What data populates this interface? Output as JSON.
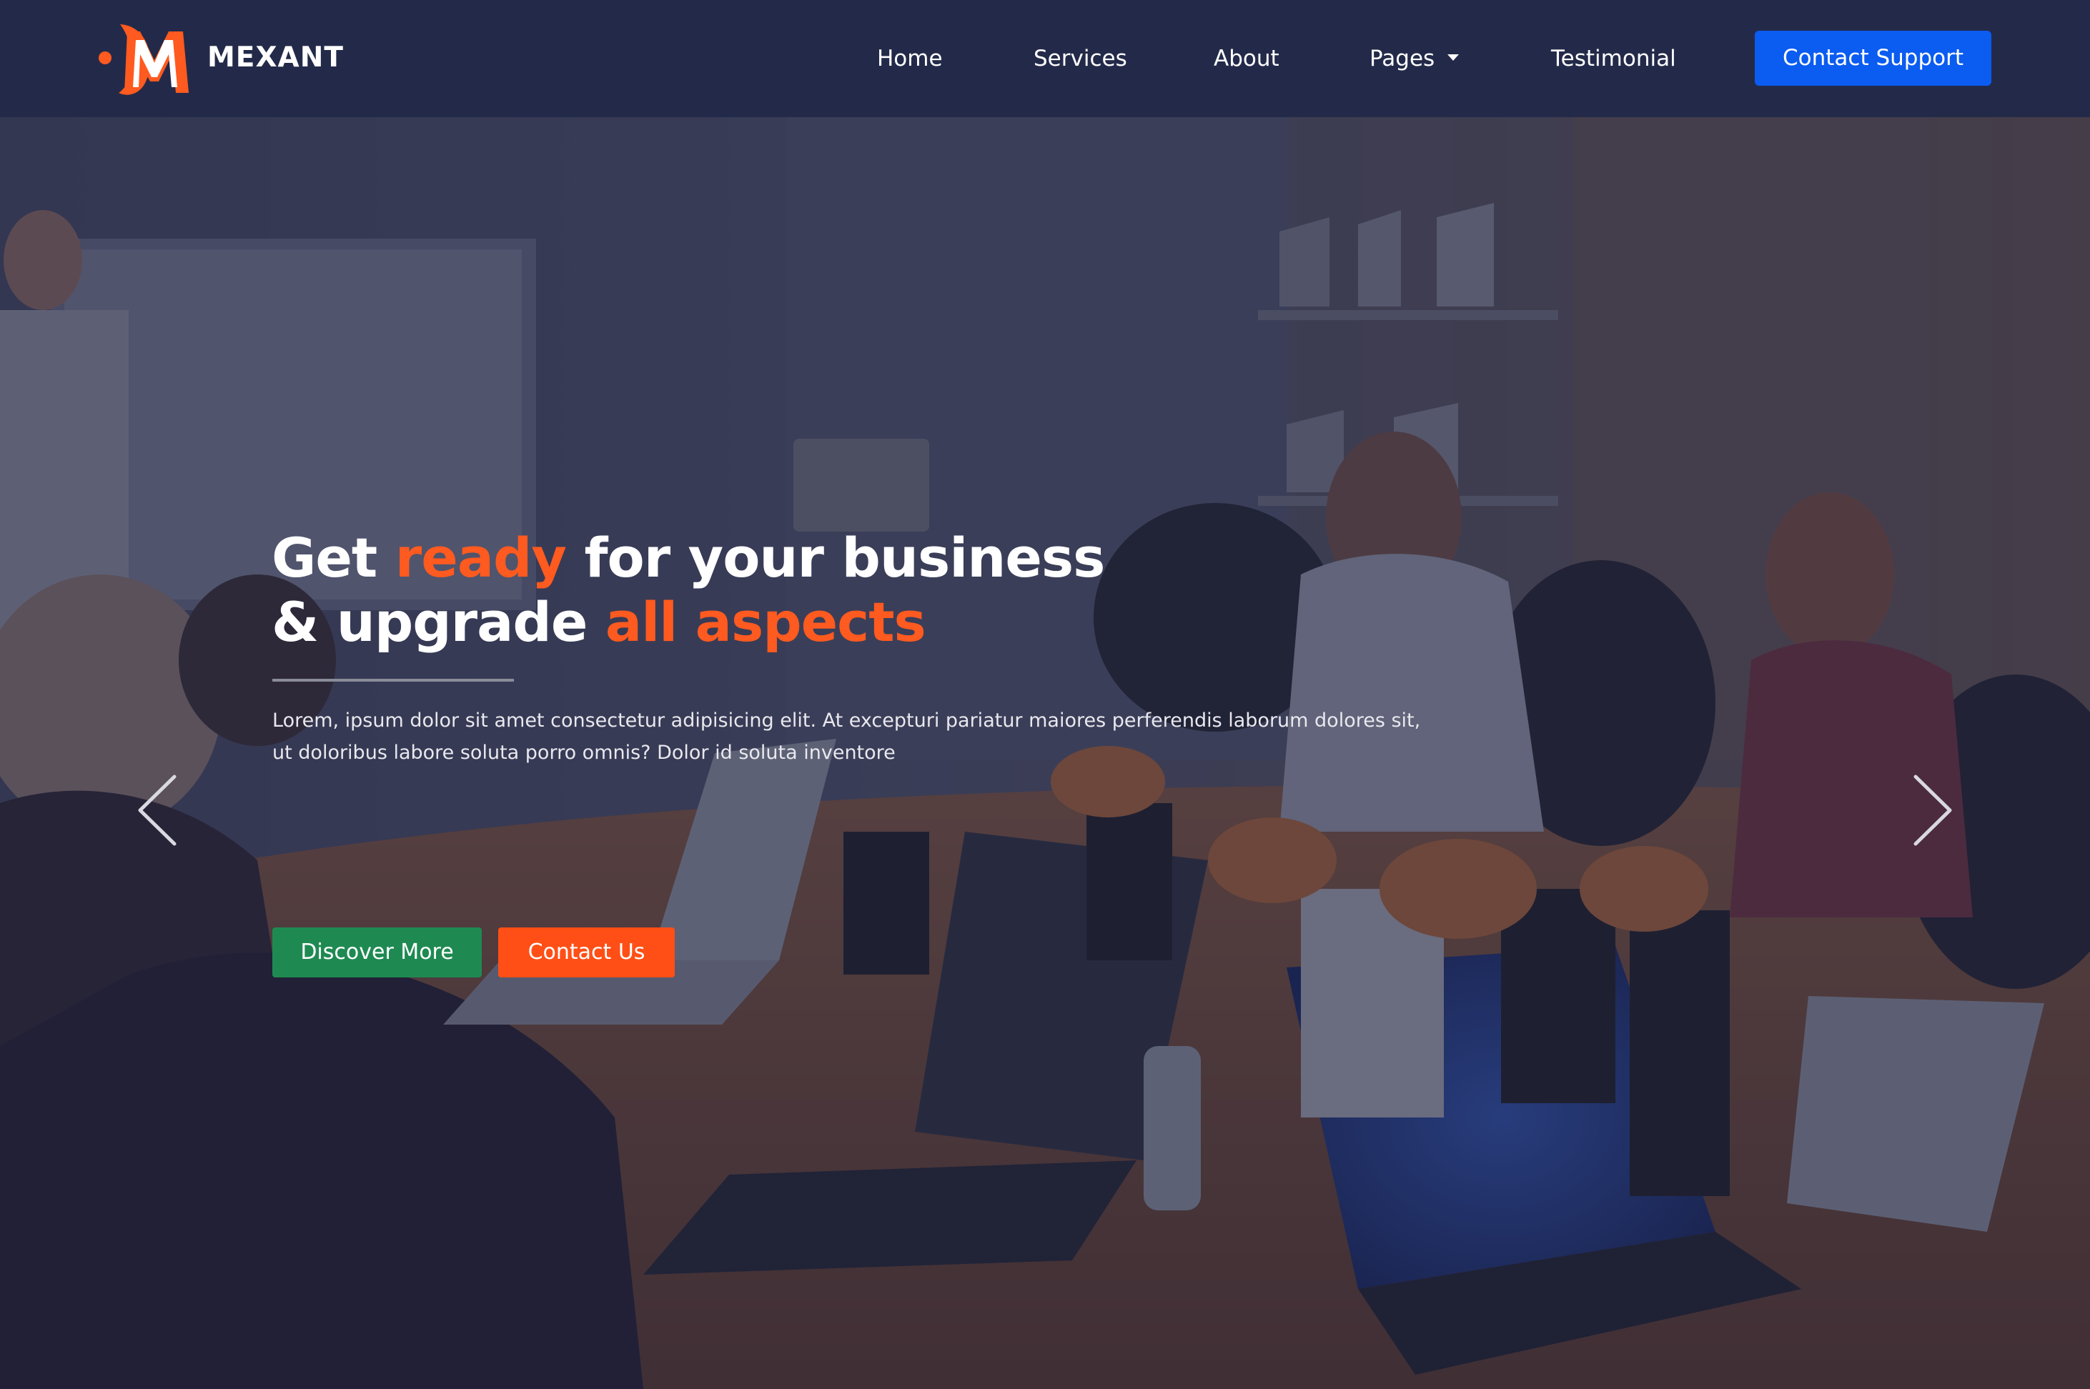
{
  "brand": {
    "name": "MEXANT",
    "logo_icon": "m-logo-icon",
    "accent_color": "#ff5a1f"
  },
  "nav": {
    "home": "Home",
    "services": "Services",
    "about": "About",
    "pages": "Pages",
    "testimonial": "Testimonial",
    "contact_support": "Contact Support"
  },
  "hero": {
    "headline": {
      "line1_part1": "Get ",
      "line1_accent": "ready",
      "line1_part2": " for your business",
      "line2_part1": "& upgrade ",
      "line2_accent": "all aspects"
    },
    "description": "Lorem, ipsum dolor sit amet consectetur adipisicing elit. At excepturi pariatur maiores perferendis laborum dolores sit, ut doloribus labore soluta porro omnis? Dolor id soluta inventore",
    "discover_button": "Discover More",
    "contact_button": "Contact Us",
    "prev_icon": "chevron-left-icon",
    "next_icon": "chevron-right-icon"
  },
  "colors": {
    "navbar_bg": "#232a49",
    "primary_blue": "#0b5cf0",
    "green": "#1e8a52",
    "orange": "#ff4f16"
  }
}
